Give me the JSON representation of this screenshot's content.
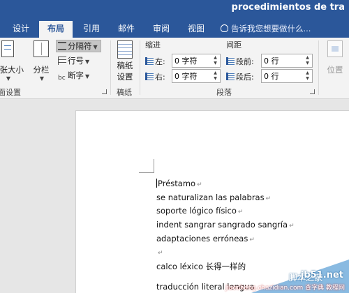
{
  "window": {
    "title": "procedimientos de tra"
  },
  "tabs": [
    {
      "label": "设计"
    },
    {
      "label": "布局"
    },
    {
      "label": "引用"
    },
    {
      "label": "邮件"
    },
    {
      "label": "审阅"
    },
    {
      "label": "视图"
    }
  ],
  "active_tab": "布局",
  "tell_me": {
    "placeholder": "告诉我您想要做什么..."
  },
  "ribbon": {
    "page_setup": {
      "size_label": "纸张大小",
      "columns_label": "分栏",
      "breaks_label": "分隔符",
      "line_numbers_label": "行号",
      "hyphenation_label": "断字",
      "group_label": "页面设置"
    },
    "manuscript": {
      "button_label_1": "稿纸",
      "button_label_2": "设置",
      "group_label": "稿纸"
    },
    "paragraph": {
      "indent_title": "缩进",
      "spacing_title": "间距",
      "left_label": "左:",
      "right_label": "右:",
      "before_label": "段前:",
      "after_label": "段后:",
      "left_value": "0 字符",
      "right_value": "0 字符",
      "before_value": "0 行",
      "after_value": "0 行",
      "group_label": "段落"
    },
    "arrange": {
      "position_label": "位置"
    }
  },
  "document": {
    "lines": [
      "Préstamo",
      "se naturalizan las palabras",
      "soporte lógico físico",
      "indent sangrar sangrado sangría",
      "adaptaciones erróneas",
      "",
      "calco léxico  长得一样的",
      "traducción literal lengua"
    ],
    "paragraph_mark": "↵"
  },
  "watermark": {
    "site": "jb51.net",
    "cn": "脚本之家",
    "url": "jiaocheng.chazidian.com",
    "cn2": "查字典 教程网"
  },
  "colors": {
    "accent": "#2b579a",
    "ribbon_bg": "#f3f3f3",
    "canvas_bg": "#e6e6e6"
  }
}
